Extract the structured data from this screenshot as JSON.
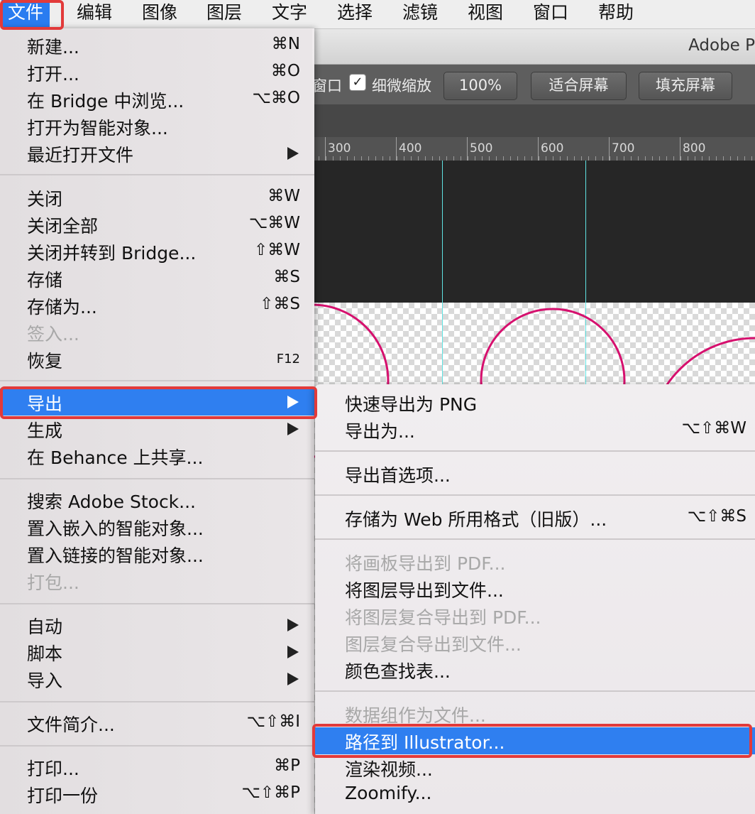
{
  "menubar": {
    "items": [
      "文件",
      "编辑",
      "图像",
      "图层",
      "文字",
      "选择",
      "滤镜",
      "视图",
      "窗口",
      "帮助"
    ]
  },
  "window": {
    "title": "Adobe P",
    "options": {
      "partial_label": "窗口",
      "checkbox_label": "细微缩放",
      "checkbox_checked": true,
      "zoom_button": "100%",
      "fit_button": "适合屏幕",
      "fill_button": "填充屏幕"
    },
    "ruler_marks": [
      "300",
      "400",
      "500",
      "600",
      "700",
      "800"
    ]
  },
  "file_menu": {
    "group1": [
      {
        "label": "新建...",
        "shortcut": "⌘N"
      },
      {
        "label": "打开...",
        "shortcut": "⌘O"
      },
      {
        "label": "在 Bridge 中浏览...",
        "shortcut": "⌥⌘O"
      },
      {
        "label": "打开为智能对象...",
        "shortcut": ""
      },
      {
        "label": "最近打开文件",
        "shortcut": ""
      }
    ],
    "group2": [
      {
        "label": "关闭",
        "shortcut": "⌘W"
      },
      {
        "label": "关闭全部",
        "shortcut": "⌥⌘W"
      },
      {
        "label": "关闭并转到 Bridge...",
        "shortcut": "⇧⌘W"
      },
      {
        "label": "存储",
        "shortcut": "⌘S"
      },
      {
        "label": "存储为...",
        "shortcut": "⇧⌘S"
      },
      {
        "label": "签入...",
        "shortcut": ""
      },
      {
        "label": "恢复",
        "shortcut": "F12"
      }
    ],
    "group3": [
      {
        "label": "导出"
      },
      {
        "label": "生成"
      },
      {
        "label": "在 Behance 上共享..."
      }
    ],
    "group4": [
      {
        "label": "搜索 Adobe Stock..."
      },
      {
        "label": "置入嵌入的智能对象..."
      },
      {
        "label": "置入链接的智能对象..."
      },
      {
        "label": "打包..."
      }
    ],
    "group5": [
      {
        "label": "自动"
      },
      {
        "label": "脚本"
      },
      {
        "label": "导入"
      }
    ],
    "group6": [
      {
        "label": "文件简介...",
        "shortcut": "⌥⇧⌘I"
      }
    ],
    "group7": [
      {
        "label": "打印...",
        "shortcut": "⌘P"
      },
      {
        "label": "打印一份",
        "shortcut": "⌥⇧⌘P"
      }
    ]
  },
  "export_submenu": {
    "items": [
      {
        "label": "快速导出为 PNG",
        "shortcut": ""
      },
      {
        "label": "导出为...",
        "shortcut": "⌥⇧⌘W"
      },
      {
        "label": "导出首选项..."
      },
      {
        "label": "存储为 Web 所用格式（旧版）...",
        "shortcut": "⌥⇧⌘S"
      },
      {
        "label": "将画板导出到 PDF..."
      },
      {
        "label": "将图层导出到文件..."
      },
      {
        "label": "将图层复合导出到 PDF..."
      },
      {
        "label": "图层复合导出到文件..."
      },
      {
        "label": "颜色查找表..."
      },
      {
        "label": "数据组作为文件..."
      },
      {
        "label": "路径到 Illustrator..."
      },
      {
        "label": "渲染视频..."
      },
      {
        "label": "Zoomify..."
      }
    ]
  },
  "colors": {
    "highlight": "#2f7ff0",
    "annotation": "#e23a3a",
    "path_stroke": "#d6106e",
    "guide": "#5fe3e3"
  }
}
